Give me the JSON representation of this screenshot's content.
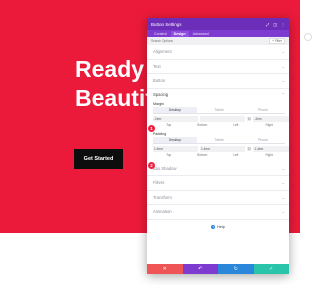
{
  "hero": {
    "title": "Ready t\nBeautif",
    "button_label": "Get Started"
  },
  "panel": {
    "title": "Button Settings",
    "tabs": [
      "Content",
      "Design",
      "Advanced"
    ],
    "search_placeholder": "Search Options",
    "filter_label": "+ Filter",
    "sections_top": [
      "Alignment",
      "Text",
      "Button"
    ],
    "spacing": {
      "title": "Spacing",
      "margin_label": "Margin",
      "padding_label": "Padding",
      "device_tabs": [
        "Desktop",
        "Tablet",
        "Phone"
      ],
      "margin_values": [
        "-2em",
        "",
        "-2em",
        ""
      ],
      "padding_values": [
        "1.4em",
        "1.4em",
        "1.4em",
        "1.4em"
      ],
      "side_labels": [
        "Top",
        "Bottom",
        "Left",
        "Right"
      ]
    },
    "sections_bottom": [
      "Box Shadow",
      "Filters",
      "Transform",
      "Animation"
    ],
    "help_label": "Help"
  },
  "markers": [
    "1",
    "2"
  ],
  "colors": {
    "hero_bg": "#ec1a3a",
    "header": "#6c2eb9",
    "cancel": "#ef5555",
    "undo": "#7e3bd0",
    "redo": "#2b87da",
    "save": "#29c4a9"
  }
}
